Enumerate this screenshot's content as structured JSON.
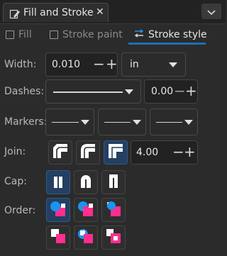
{
  "panel": {
    "title": "Fill and Stroke",
    "close_glyph": "✕",
    "menu_glyph": "⌄"
  },
  "subtabs": [
    {
      "label": "Fill",
      "active": false
    },
    {
      "label": "Stroke paint",
      "active": false
    },
    {
      "label": "Stroke style",
      "active": true
    }
  ],
  "width": {
    "label": "Width:",
    "value": "0.010",
    "unit": "in"
  },
  "dashes": {
    "label": "Dashes:",
    "offset": "0.00"
  },
  "markers": {
    "label": "Markers:"
  },
  "join": {
    "label": "Join:",
    "miter_limit": "4.00",
    "selected": "miter"
  },
  "cap": {
    "label": "Cap:",
    "selected": "butt"
  },
  "order": {
    "label": "Order:"
  },
  "signs": {
    "minus": "−",
    "plus": "+"
  },
  "colors": {
    "accent": "#1f6fb5",
    "order_fill": "#ff2e8f",
    "order_stroke": "#1a94f0"
  }
}
